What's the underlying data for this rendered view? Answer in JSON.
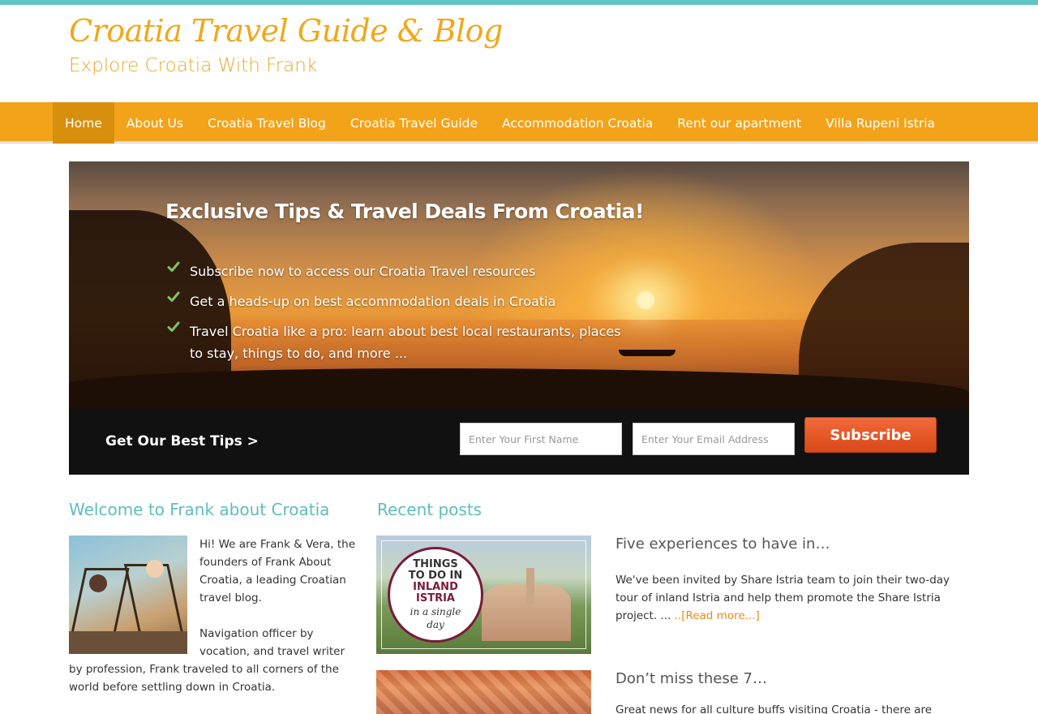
{
  "header": {
    "title": "Croatia Travel Guide & Blog",
    "tagline": "Explore Croatia With Frank"
  },
  "nav": {
    "items": [
      {
        "label": "Home",
        "active": true
      },
      {
        "label": "About Us"
      },
      {
        "label": "Croatia Travel Blog"
      },
      {
        "label": "Croatia Travel Guide"
      },
      {
        "label": "Accommodation Croatia"
      },
      {
        "label": "Rent our apartment"
      },
      {
        "label": "Villa Rupeni Istria"
      }
    ]
  },
  "hero": {
    "heading": "Exclusive Tips & Travel Deals From Croatia!",
    "bullets": [
      "Subscribe now to access our Croatia Travel resources",
      "Get a heads-up on best accommodation deals in Croatia",
      "Travel Croatia like a pro: learn about best local restaurants, places to stay, things to do, and more ..."
    ],
    "check_color": "#7cc36a"
  },
  "optin": {
    "cta": "Get Our Best Tips >",
    "first_name_placeholder": "Enter Your First Name",
    "email_placeholder": "Enter Your Email Address",
    "button_label": "Subscribe"
  },
  "welcome": {
    "title": "Welcome to Frank about Croatia",
    "paragraphs": [
      "Hi! We are Frank & Vera, the founders of Frank About Croatia, a leading Croatian travel blog.",
      "Navigation officer by vocation, and travel writer by profession, Frank traveled to all corners of the world before settling down in Croatia."
    ]
  },
  "recent": {
    "title": "Recent posts",
    "posts": [
      {
        "title": "Five experiences to have in…",
        "excerpt": "We've been invited by Share Istria team to join their two-day tour of inland Istria and help them promote the Share Istria project.  ...",
        "read_more": "..[Read more...]",
        "thumb_text": [
          "THINGS",
          "TO DO IN",
          "INLAND",
          "ISTRIA",
          "in a single",
          "day"
        ]
      },
      {
        "title": "Don’t miss these 7…",
        "excerpt": "Great news for all culture buffs visiting Croatia - there are"
      }
    ]
  },
  "colors": {
    "top_bar": "#5fc4c4",
    "brand_orange": "#f2a31a",
    "section_title": "#5fbcc0",
    "subscribe": "#e4552a"
  }
}
